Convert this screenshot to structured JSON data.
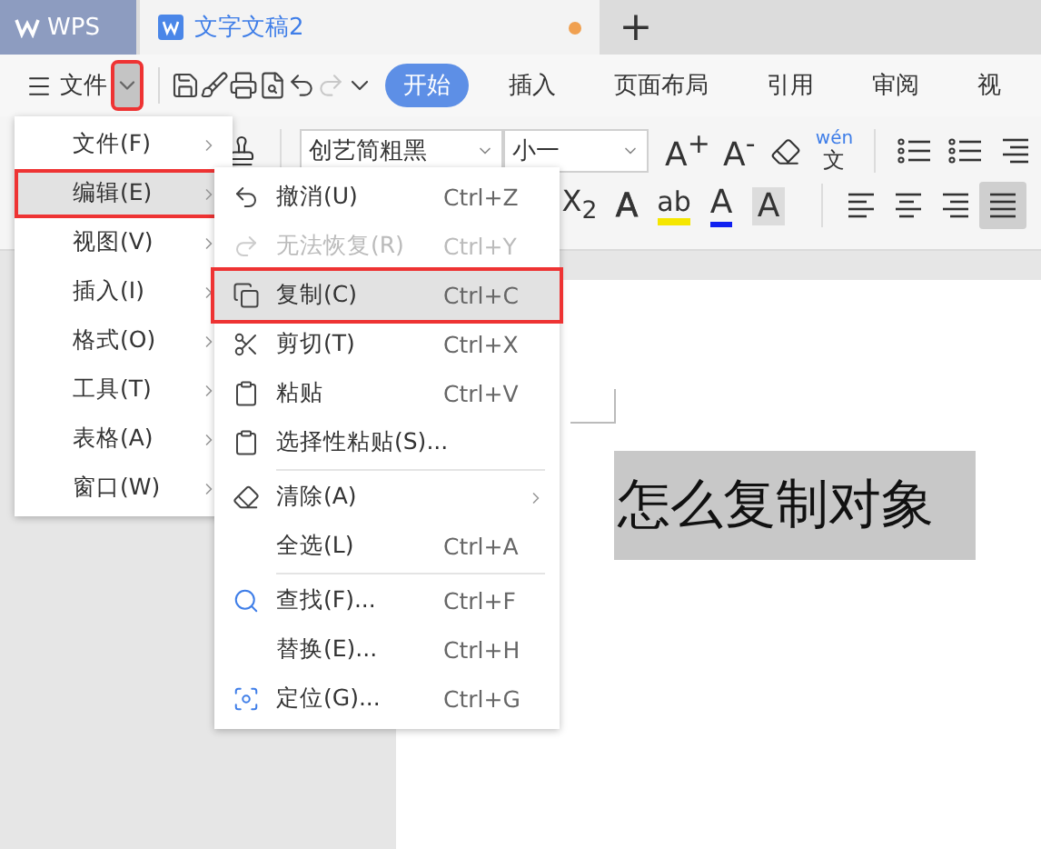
{
  "app": {
    "logo": "WPS"
  },
  "document_tab": {
    "title": "文字文稿2",
    "unsaved": true
  },
  "new_tab": "+",
  "quick_bar": {
    "menu_label": "文件",
    "dropdown_highlighted": true,
    "tools": [
      {
        "kind": "save",
        "disabled": false
      },
      {
        "kind": "brush",
        "disabled": false
      },
      {
        "kind": "print",
        "disabled": false
      },
      {
        "kind": "preview",
        "disabled": false
      },
      {
        "kind": "undo",
        "disabled": false
      },
      {
        "kind": "redo",
        "disabled": true
      },
      {
        "kind": "more",
        "disabled": false
      }
    ]
  },
  "ribbon_tabs": [
    {
      "label": "开始",
      "selected": true
    },
    {
      "label": "插入",
      "selected": false
    },
    {
      "label": "页面布局",
      "selected": false
    },
    {
      "label": "引用",
      "selected": false
    },
    {
      "label": "审阅",
      "selected": false
    },
    {
      "label": "视",
      "selected": false
    }
  ],
  "font": {
    "name": "创艺简粗黑",
    "size": "小一"
  },
  "size_buttons": [
    {
      "glyph": "A$^{+}$"
    },
    {
      "glyph": "A$^{-}$"
    }
  ],
  "phonetic": {
    "pinyin": "wén",
    "char": "文"
  },
  "format_buttons": [
    {
      "kind": "subscript",
      "glyph": "X$_{2}$"
    },
    {
      "kind": "outline",
      "glyph": "A"
    },
    {
      "kind": "highlight",
      "glyph": "ab"
    },
    {
      "kind": "color",
      "glyph": "A"
    },
    {
      "kind": "shade",
      "glyph": "A"
    }
  ],
  "align_buttons": [
    {
      "kind": "left",
      "selected": false
    },
    {
      "kind": "center",
      "selected": false
    },
    {
      "kind": "right",
      "selected": false
    },
    {
      "kind": "justify",
      "selected": true
    }
  ],
  "main_menu": [
    {
      "label": "文件(F)",
      "selected": false,
      "highlighted": false
    },
    {
      "label": "编辑(E)",
      "selected": true,
      "highlighted": true
    },
    {
      "label": "视图(V)",
      "selected": false,
      "highlighted": false
    },
    {
      "label": "插入(I)",
      "selected": false,
      "highlighted": false
    },
    {
      "label": "格式(O)",
      "selected": false,
      "highlighted": false
    },
    {
      "label": "工具(T)",
      "selected": false,
      "highlighted": false
    },
    {
      "label": "表格(A)",
      "selected": false,
      "highlighted": false
    },
    {
      "label": "窗口(W)",
      "selected": false,
      "highlighted": false
    }
  ],
  "edit_menu": [
    {
      "kind": "undo",
      "label": "撤消(U)",
      "shortcut": "Ctrl+Z",
      "disabled": false,
      "selected": false,
      "highlighted": false,
      "submenu": false,
      "separator_before": false
    },
    {
      "kind": "redo",
      "label": "无法恢复(R)",
      "shortcut": "Ctrl+Y",
      "disabled": true,
      "selected": false,
      "highlighted": false,
      "submenu": false,
      "separator_before": false
    },
    {
      "kind": "copy",
      "label": "复制(C)",
      "shortcut": "Ctrl+C",
      "disabled": false,
      "selected": true,
      "highlighted": true,
      "submenu": false,
      "separator_before": false
    },
    {
      "kind": "cut",
      "label": "剪切(T)",
      "shortcut": "Ctrl+X",
      "disabled": false,
      "selected": false,
      "highlighted": false,
      "submenu": false,
      "separator_before": false
    },
    {
      "kind": "paste",
      "label": "粘贴",
      "shortcut": "Ctrl+V",
      "disabled": false,
      "selected": false,
      "highlighted": false,
      "submenu": false,
      "separator_before": false
    },
    {
      "kind": "paste_special",
      "label": "选择性粘贴(S)...",
      "disabled": false,
      "selected": false,
      "highlighted": false,
      "submenu": false,
      "separator_before": false
    },
    {
      "kind": "erase",
      "label": "清除(A)",
      "disabled": false,
      "selected": false,
      "highlighted": false,
      "submenu": true,
      "separator_before": true
    },
    {
      "kind": "plain",
      "label": "全选(L)",
      "shortcut": "Ctrl+A",
      "disabled": false,
      "selected": false,
      "highlighted": false,
      "submenu": false,
      "separator_before": false
    },
    {
      "kind": "find",
      "label": "查找(F)...",
      "shortcut": "Ctrl+F",
      "disabled": false,
      "selected": false,
      "highlighted": false,
      "submenu": false,
      "separator_before": true
    },
    {
      "kind": "plain",
      "label": "替换(E)...",
      "shortcut": "Ctrl+H",
      "disabled": false,
      "selected": false,
      "highlighted": false,
      "submenu": false,
      "separator_before": false
    },
    {
      "kind": "locate",
      "label": "定位(G)...",
      "shortcut": "Ctrl+G",
      "disabled": false,
      "selected": false,
      "highlighted": false,
      "submenu": false,
      "separator_before": false
    }
  ],
  "document": {
    "text": "怎么复制对象",
    "selected": true
  }
}
